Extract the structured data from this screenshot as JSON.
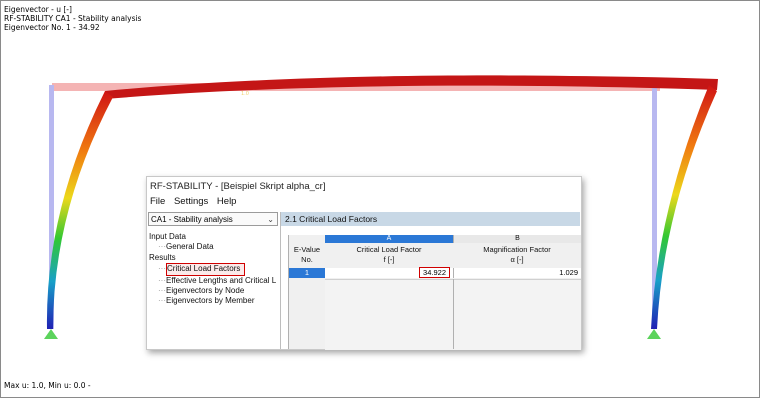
{
  "viewport": {
    "info_lines": [
      "Eigenvector - u [-]",
      "RF-STABILITY CA1 - Stability analysis",
      "Eigenvector No. 1  -  34.92"
    ],
    "footer": "Max u: 1.0, Min u: 0.0 -"
  },
  "dialog": {
    "title": "RF-STABILITY - [Beispiel Skript alpha_cr]",
    "menu": [
      "File",
      "Settings",
      "Help"
    ],
    "load_case": "CA1 - Stability analysis",
    "tree": [
      {
        "label": "Input Data",
        "level": 0
      },
      {
        "label": "General Data",
        "level": 1
      },
      {
        "label": "Results",
        "level": 0
      },
      {
        "label": "Critical Load Factors",
        "level": 1,
        "active": true
      },
      {
        "label": "Effective Lengths and Critical L",
        "level": 1
      },
      {
        "label": "Eigenvectors by Node",
        "level": 1
      },
      {
        "label": "Eigenvectors by Member",
        "level": 1
      }
    ],
    "section_title": "2.1 Critical Load Factors",
    "table": {
      "col_letters": [
        "A",
        "B"
      ],
      "ev_header": [
        "E-Value",
        "No."
      ],
      "col_a_header": [
        "Critical Load Factor",
        "f [-]"
      ],
      "col_b_header": [
        "Magnification Factor",
        "α [-]"
      ],
      "rows": [
        {
          "no": "1",
          "critical_load_factor": "34.922",
          "magnification_factor": "1.029"
        }
      ]
    }
  },
  "colors": {
    "accent_blue": "#2b78d6",
    "highlight_red": "#d00000",
    "section_header": "#c8d8e6",
    "deformed_beam": "#c41616"
  }
}
